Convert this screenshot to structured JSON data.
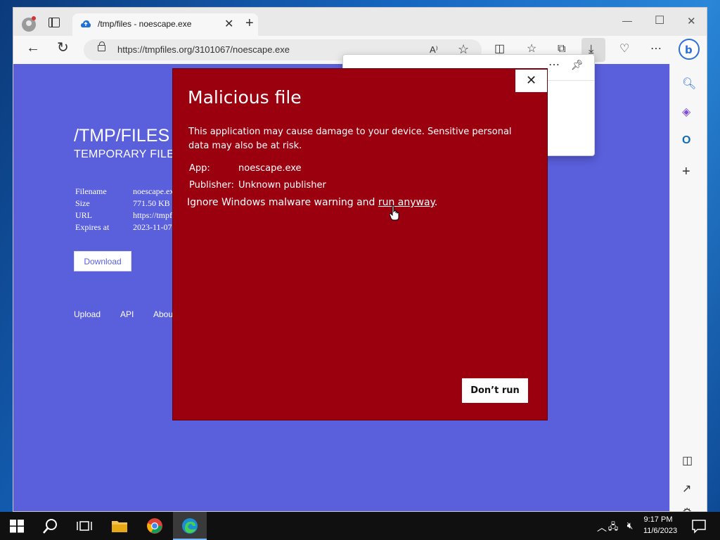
{
  "browser": {
    "tab": {
      "title": "/tmp/files - noescape.exe"
    },
    "address": {
      "url": "https://tmpfiles.org/3101067/noescape.exe"
    }
  },
  "page": {
    "title": "/TMP/FILES",
    "subtitle": "TEMPORARY FILE",
    "info": [
      {
        "label": "Filename",
        "value": "noescape.exe"
      },
      {
        "label": "Size",
        "value": "771.50 KB"
      },
      {
        "label": "URL",
        "value": "https://tmpf"
      },
      {
        "label": "Expires at",
        "value": "2023-11-07"
      }
    ],
    "download_label": "Download",
    "footer": {
      "upload": "Upload",
      "api": "API",
      "about": "Abou"
    }
  },
  "dialog": {
    "title": "Malicious file",
    "message": "This application may cause damage to your device. Sensitive personal data may also be at risk.",
    "app_label": "App:",
    "app_value": "noescape.exe",
    "publisher_label": "Publisher:",
    "publisher_value": "Unknown publisher",
    "warning_prefix": "Ignore Windows malware warning and ",
    "run_anyway": "run anyway",
    "warning_suffix": ".",
    "dont_run": "Don’t run",
    "close": "✕"
  },
  "taskbar": {
    "time": "9:17 PM",
    "date": "11/6/2023"
  },
  "colors": {
    "page_bg": "#5a5fdc",
    "dialog_bg": "#9b000e"
  }
}
